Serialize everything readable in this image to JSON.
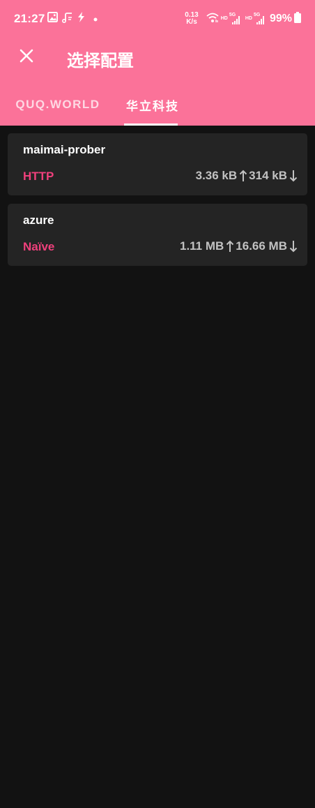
{
  "status_bar": {
    "time": "21:27",
    "net_speed_value": "0.13",
    "net_speed_unit": "K/s",
    "hd_1": "HD",
    "sig_1": "5G",
    "hd_2": "HD",
    "sig_2": "5G",
    "battery": "99%",
    "icons": [
      "image-icon",
      "music-icon",
      "flash-icon",
      "dot-icon",
      "wifi-icon",
      "signal-icon",
      "signal-icon",
      "battery-icon"
    ]
  },
  "toolbar": {
    "title": "选择配置",
    "close_icon": "close-icon"
  },
  "tabs": [
    {
      "label": "QUQ.WORLD",
      "selected": false
    },
    {
      "label": "华立科技",
      "selected": true
    }
  ],
  "profiles": [
    {
      "name": "maimai-prober",
      "type": "HTTP",
      "upload": "3.36 kB",
      "download": "314 kB"
    },
    {
      "name": "azure",
      "type": "Naïve",
      "upload": "1.11 MB",
      "download": "16.66 MB"
    }
  ],
  "colors": {
    "header": "#fb7299",
    "accent": "#f0407c",
    "background": "#121212",
    "card": "#242424",
    "traffic_text": "#c2c2c2"
  }
}
